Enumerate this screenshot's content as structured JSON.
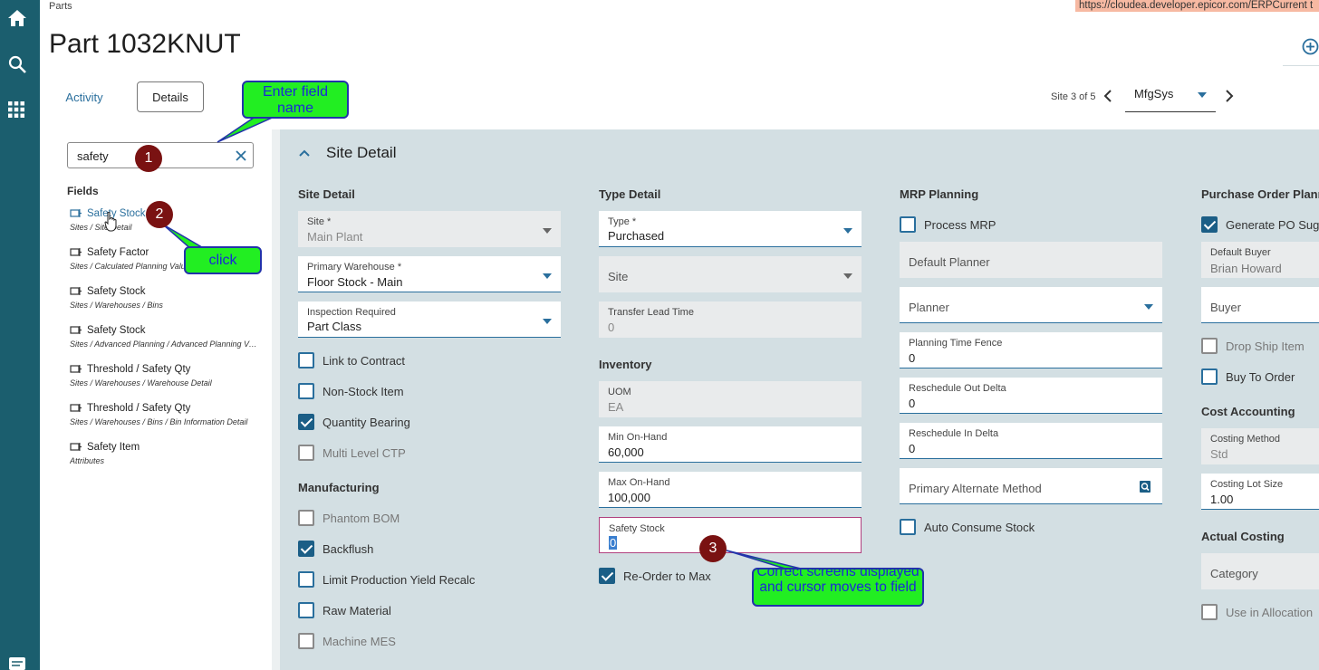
{
  "app": {
    "breadcrumb": "Parts",
    "url": "https://cloudea.developer.epicor.com/ERPCurrent  t",
    "title": "Part 1032KNUT"
  },
  "tabs": {
    "activity": "Activity",
    "details": "Details"
  },
  "site_nav": {
    "label": "Site 3 of 5",
    "selected": "MfgSys"
  },
  "search": {
    "value": "safety"
  },
  "fields_heading": "Fields",
  "results": [
    {
      "name": "Safety Stock",
      "path": "Sites / Site Detail"
    },
    {
      "name": "Safety Factor",
      "path": "Sites / Calculated Planning Values"
    },
    {
      "name": "Safety Stock",
      "path": "Sites / Warehouses / Bins"
    },
    {
      "name": "Safety Stock",
      "path": "Sites / Advanced Planning / Advanced Planning Values"
    },
    {
      "name": "Threshold / Safety Qty",
      "path": "Sites / Warehouses / Warehouse Detail"
    },
    {
      "name": "Threshold / Safety Qty",
      "path": "Sites / Warehouses / Bins / Bin Information Detail"
    },
    {
      "name": "Safety Item",
      "path": "Attributes"
    }
  ],
  "panel_title": "Site Detail",
  "col1": {
    "heading": "Site Detail",
    "site": {
      "label": "Site *",
      "value": "Main Plant"
    },
    "warehouse": {
      "label": "Primary Warehouse *",
      "value": "Floor Stock - Main"
    },
    "inspection": {
      "label": "Inspection Required",
      "value": "Part Class"
    },
    "checks": [
      "Link to Contract",
      "Non-Stock Item",
      "Quantity Bearing",
      "Multi Level CTP"
    ],
    "mfg_heading": "Manufacturing",
    "mfg_checks": [
      "Phantom BOM",
      "Backflush",
      "Limit Production Yield Recalc",
      "Raw Material",
      "Machine MES"
    ]
  },
  "col2": {
    "heading": "Type Detail",
    "type": {
      "label": "Type *",
      "value": "Purchased"
    },
    "site_placeholder": "Site",
    "transfer": {
      "label": "Transfer Lead Time",
      "value": "0"
    },
    "inv_heading": "Inventory",
    "uom": {
      "label": "UOM",
      "value": "EA"
    },
    "min": {
      "label": "Min On-Hand",
      "value": "60,000"
    },
    "max": {
      "label": "Max On-Hand",
      "value": "100,000"
    },
    "safety": {
      "label": "Safety Stock",
      "value": "0"
    },
    "reorder": "Re-Order to Max"
  },
  "col3": {
    "heading": "MRP Planning",
    "process_mrp": "Process MRP",
    "default_planner": "Default Planner",
    "planner": "Planner",
    "ptf": {
      "label": "Planning Time Fence",
      "value": "0"
    },
    "rod": {
      "label": "Reschedule Out Delta",
      "value": "0"
    },
    "rid": {
      "label": "Reschedule In Delta",
      "value": "0"
    },
    "pam": "Primary Alternate Method",
    "auto": "Auto Consume Stock"
  },
  "col4": {
    "heading": "Purchase Order Planni",
    "gen_po": "Generate PO Sugg",
    "buyer_default": {
      "label": "Default Buyer",
      "value": "Brian Howard"
    },
    "buyer": "Buyer",
    "drop": "Drop Ship Item",
    "bto": "Buy To Order",
    "cost_heading": "Cost Accounting",
    "cost_method": {
      "label": "Costing Method",
      "value": "Std"
    },
    "cost_lot": {
      "label": "Costing Lot Size",
      "value": "1.00"
    },
    "actual_heading": "Actual Costing",
    "category": "Category",
    "alloc": "Use in Allocation"
  },
  "annotations": {
    "callout1": "Enter field name",
    "callout2": "click",
    "callout3": "Correct screens displayed and cursor moves to field",
    "step1": "1",
    "step2": "2",
    "step3": "3"
  },
  "colors": {
    "rail": "#1b5e6e",
    "accent": "#2a6f9d",
    "panel_bg": "#d3dfe3",
    "callout": "#22ee22",
    "step": "#7a1212"
  }
}
